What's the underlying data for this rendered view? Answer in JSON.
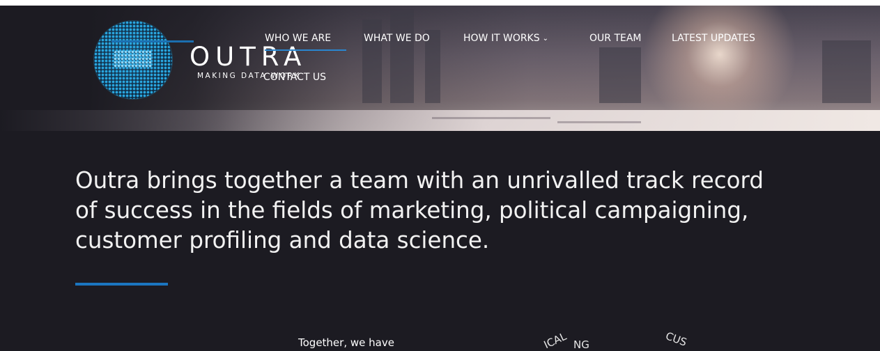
{
  "brand": {
    "name": "OUTRA",
    "tagline": "MAKING DATA WORK"
  },
  "nav": {
    "items": [
      {
        "label": "WHO WE ARE"
      },
      {
        "label": "WHAT WE DO"
      },
      {
        "label": "HOW IT WORKS",
        "has_dropdown": true
      },
      {
        "label": "OUR TEAM"
      },
      {
        "label": "LATEST UPDATES"
      },
      {
        "label": "CONTACT US"
      }
    ]
  },
  "hero": {
    "headline": "Outra brings together a team with an unrivalled track record of success in the fields of marketing, political campaigning, customer profiling and data science."
  },
  "section": {
    "intro": "Together, we have",
    "curved_a": "ICAL",
    "curved_a2": "NG",
    "curved_b": "CUS"
  },
  "colors": {
    "background": "#1c1b22",
    "accent": "#1b75c0",
    "logo_dots": "#2aa7e0"
  },
  "icons": {
    "dropdown": "chevron-down-icon",
    "logo": "dotted-globe-logo-icon"
  }
}
